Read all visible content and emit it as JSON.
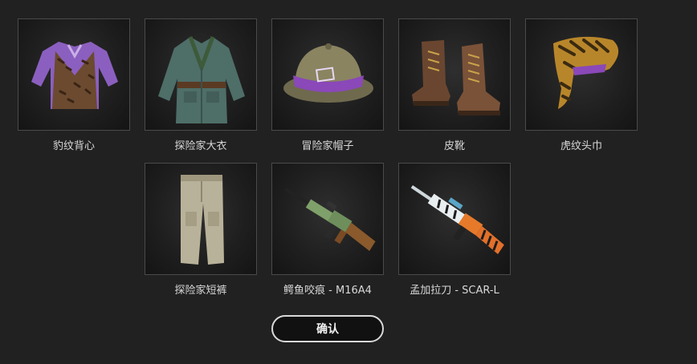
{
  "items": [
    {
      "label": "豹纹背心",
      "icon": "leopard-vest-icon"
    },
    {
      "label": "探险家大衣",
      "icon": "explorer-jacket-icon"
    },
    {
      "label": "冒险家帽子",
      "icon": "pith-helmet-icon"
    },
    {
      "label": "皮靴",
      "icon": "leather-boots-icon"
    },
    {
      "label": "虎纹头巾",
      "icon": "tiger-bandana-icon"
    },
    {
      "label": "探险家短裤",
      "icon": "explorer-pants-icon"
    },
    {
      "label": "鳄鱼咬痕 - M16A4",
      "icon": "m16a4-rifle-icon"
    },
    {
      "label": "孟加拉刀 - SCAR-L",
      "icon": "scar-l-rifle-icon"
    }
  ],
  "confirm_label": "确认",
  "colors": {
    "background": "#212121",
    "tile_border": "#4a4a4a",
    "button_border": "#d9d9d9"
  }
}
